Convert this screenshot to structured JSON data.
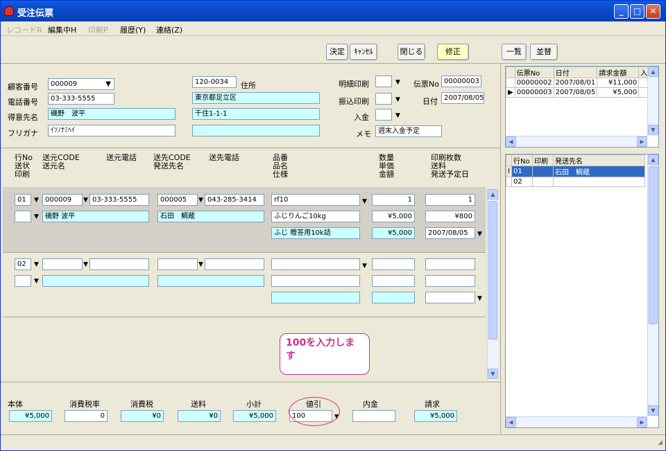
{
  "window": {
    "title": "受注伝票"
  },
  "menu": {
    "items": [
      "レコードR",
      "編集中H",
      "印刷P",
      "履歴(Y)",
      "連絡(Z)"
    ]
  },
  "toolbar": {
    "decide": "決定",
    "cancel": "ｷｬﾝｾﾙ",
    "close": "閉じる",
    "edit": "修正",
    "list": "一覧",
    "sort": "並替"
  },
  "header": {
    "customer_no_label": "顧客番号",
    "customer_no": "000009",
    "phone_label": "電話番号",
    "phone": "03-333-5555",
    "client_label": "得意先名",
    "client": "磯野　波平",
    "furigana_label": "フリガナ",
    "furigana": "ｲｿﾉﾅﾐﾍｲ",
    "zip": "120-0034",
    "address_label": "住所",
    "address1": "東京都足立区",
    "address2": "千住1-1-1",
    "address3": "",
    "detail_print_label": "明細印刷",
    "transfer_print_label": "振込印刷",
    "deposit_label": "入金",
    "memo_label": "メモ",
    "memo": "週末入金予定",
    "slip_no_label": "伝票No",
    "slip_no": "00000003",
    "date_label": "日付",
    "date": "2007/08/05"
  },
  "columns": {
    "c1": "行No\n送状\n印刷",
    "c2": "送元CODE\n送元名",
    "c3": "送元電話",
    "c4": "送先CODE\n発送先名",
    "c5": "送先電話",
    "c6": "品番\n品名\n仕様",
    "c7": "数量\n単価\n金額",
    "c8": "印刷枚数\n送料\n発送予定日"
  },
  "lines": [
    {
      "no": "01",
      "src_code": "000009",
      "src_phone": "03-333-5555",
      "src_name": "磯野 波平",
      "dst_code": "000005",
      "dst_phone": "043-285-3414",
      "dst_name": "石田　鯛蔵",
      "item_no": "rf10",
      "item_name": "ふじりんご10kg",
      "item_spec": "ふじ 贈答用10k詰",
      "qty": "1",
      "price": "¥5,000",
      "amount": "¥5,000",
      "copies": "1",
      "shipping": "¥800",
      "ship_date": "2007/08/05"
    },
    {
      "no": "02",
      "src_code": "",
      "src_phone": "",
      "src_name": "",
      "dst_code": "",
      "dst_phone": "",
      "dst_name": "",
      "item_no": "",
      "item_name": "",
      "item_spec": "",
      "qty": "",
      "price": "",
      "amount": "",
      "copies": "",
      "shipping": "",
      "ship_date": ""
    }
  ],
  "callout": {
    "text": "100を入力します"
  },
  "totals": {
    "base_label": "本体",
    "base": "¥5,000",
    "taxrate_label": "消費税率",
    "taxrate": "0",
    "tax_label": "消費税",
    "tax": "¥0",
    "shipping_label": "送料",
    "shipping": "¥0",
    "subtotal_label": "小計",
    "subtotal": "¥5,000",
    "discount_label": "値引",
    "discount": "100",
    "deposit_label": "内金",
    "deposit": "",
    "bill_label": "請求",
    "bill": "¥5,000"
  },
  "slip_list": {
    "headers": [
      "伝票No",
      "日付",
      "請求金額",
      "入"
    ],
    "rows": [
      {
        "no": "00000002",
        "date": "2007/08/01",
        "amount": "¥11,000"
      },
      {
        "no": "00000003",
        "date": "2007/08/05",
        "amount": "¥5,000"
      }
    ]
  },
  "dest_list": {
    "headers": [
      "行No",
      "印刷",
      "発送先名"
    ],
    "rows": [
      {
        "no": "01",
        "print": "",
        "name": "石田　鯛蔵"
      },
      {
        "no": "02",
        "print": "",
        "name": ""
      }
    ]
  },
  "colors": {
    "title_bar": "#0a49c8",
    "field_cyan": "#ccffff",
    "edit_button": "#ffffc0",
    "callout": "#d4308a",
    "selection": "#316ac5"
  }
}
